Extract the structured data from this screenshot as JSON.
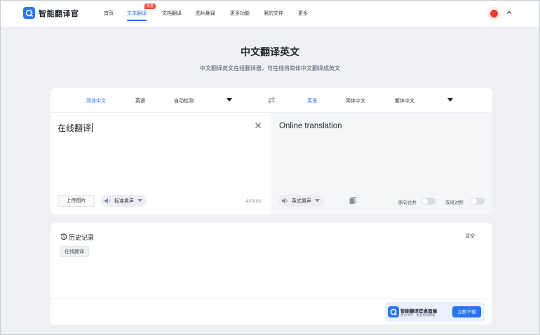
{
  "app": {
    "name": "智能翻译官"
  },
  "nav": {
    "items": [
      {
        "label": "首页"
      },
      {
        "label": "文本翻译",
        "badge": "免费"
      },
      {
        "label": "文档翻译"
      },
      {
        "label": "图片翻译"
      },
      {
        "label": "更多功能"
      },
      {
        "label": "我的文件"
      },
      {
        "label": "更多"
      }
    ],
    "active_index": 1
  },
  "hero": {
    "title": "中文翻译英文",
    "subtitle": "中文翻译英文在线翻译器，可在线将简体中文翻译成英文"
  },
  "translator": {
    "source_langs": [
      "简体中文",
      "英语",
      "自动检测"
    ],
    "target_langs": [
      "英语",
      "简体中文",
      "繁体中文"
    ],
    "source_text": "在线翻译",
    "target_text": "Online translation",
    "upload_label": "上传图片",
    "source_voice": "标准男声",
    "target_voice": "英式男声",
    "char_count": "4/5000",
    "toggle_merge": "断句合并",
    "toggle_bilingual": "双语对照"
  },
  "history": {
    "title": "历史记录",
    "clear_label": "清空",
    "items": [
      "在线翻译"
    ]
  },
  "promo": {
    "title": "智能翻译官桌面端",
    "subtitle": "更大文件，更多格式网络",
    "button": "立即下载"
  },
  "colors": {
    "accent": "#2b74f5",
    "badge": "#f0483e",
    "background": "#eef0f4"
  }
}
